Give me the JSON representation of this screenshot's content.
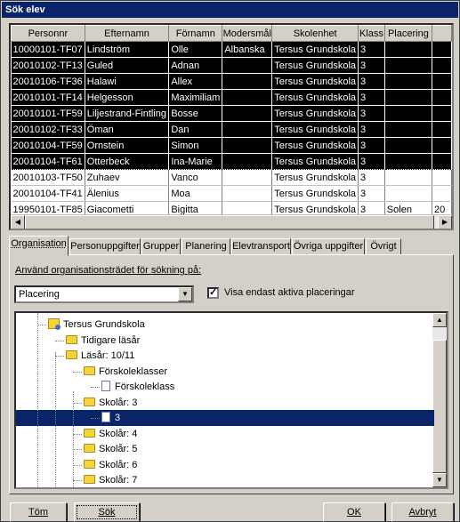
{
  "window": {
    "title": "Sök elev"
  },
  "grid": {
    "columns": [
      "Personnr",
      "Efternamn",
      "Förnamn",
      "Modersmål",
      "Skolenhet",
      "Klass",
      "Placering",
      ""
    ],
    "rows": [
      {
        "selected": true,
        "cells": [
          "10000101-TF07",
          "Lindström",
          "Olle",
          "Albanska",
          "Tersus Grundskola",
          "3",
          "",
          ""
        ]
      },
      {
        "selected": true,
        "cells": [
          "20010102-TF13",
          "Guled",
          "Adnan",
          "",
          "Tersus Grundskola",
          "3",
          "",
          ""
        ]
      },
      {
        "selected": true,
        "cells": [
          "20010106-TF36",
          "Halawi",
          "Allex",
          "",
          "Tersus Grundskola",
          "3",
          "",
          ""
        ]
      },
      {
        "selected": true,
        "cells": [
          "20010101-TF14",
          "Helgesson",
          "Maximiliam",
          "",
          "Tersus Grundskola",
          "3",
          "",
          ""
        ]
      },
      {
        "selected": true,
        "cells": [
          "20010101-TF59",
          "Liljestrand-Fintling",
          "Bosse",
          "",
          "Tersus Grundskola",
          "3",
          "",
          ""
        ]
      },
      {
        "selected": true,
        "cells": [
          "20010102-TF33",
          "Öman",
          "Dan",
          "",
          "Tersus Grundskola",
          "3",
          "",
          ""
        ]
      },
      {
        "selected": true,
        "cells": [
          "20010104-TF59",
          "Ornstein",
          "Simon",
          "",
          "Tersus Grundskola",
          "3",
          "",
          ""
        ]
      },
      {
        "selected": true,
        "current": true,
        "cells": [
          "20010104-TF61",
          "Otterbeck",
          "Ina-Marie",
          "",
          "Tersus Grundskola",
          "3",
          "",
          ""
        ]
      },
      {
        "selected": false,
        "cells": [
          "20010103-TF50",
          "Zuhaev",
          "Vanco",
          "",
          "Tersus Grundskola",
          "3",
          "",
          ""
        ]
      },
      {
        "selected": false,
        "cells": [
          "20010104-TF41",
          "Älenius",
          "Moa",
          "",
          "Tersus Grundskola",
          "3",
          "",
          ""
        ]
      },
      {
        "selected": false,
        "cells": [
          "19950101-TF85",
          "Giacometti",
          "Bigitta",
          "",
          "Tersus Grundskola",
          "3",
          "Solen",
          "20"
        ]
      }
    ]
  },
  "tabs": [
    {
      "label": "Organisation",
      "active": true
    },
    {
      "label": "Personuppgifter",
      "active": false
    },
    {
      "label": "Grupper",
      "active": false
    },
    {
      "label": "Planering",
      "active": false
    },
    {
      "label": "Elevtransport",
      "active": false
    },
    {
      "label": "Övriga uppgifter",
      "active": false
    },
    {
      "label": "Övrigt",
      "active": false
    }
  ],
  "organisation": {
    "search_label": "Använd organisationsträdet för sökning på:",
    "search_select_value": "Placering",
    "active_only_label": "Visa endast aktiva placeringar",
    "active_only_checked": true,
    "tree": [
      {
        "label": "Tersus Grundskola",
        "level": 0,
        "icon": "school-icon"
      },
      {
        "label": "Tidigare läsår",
        "level": 1,
        "icon": "folder-icon"
      },
      {
        "label": "Läsår: 10/11",
        "level": 1,
        "icon": "folder-icon"
      },
      {
        "label": "Förskoleklasser",
        "level": 2,
        "icon": "folder-icon"
      },
      {
        "label": "Förskoleklass",
        "level": 3,
        "icon": "page-icon"
      },
      {
        "label": "Skolår: 3",
        "level": 2,
        "icon": "folder-icon"
      },
      {
        "label": "3",
        "level": 3,
        "icon": "page-icon",
        "selected": true
      },
      {
        "label": "Skolår: 4",
        "level": 2,
        "icon": "folder-icon"
      },
      {
        "label": "Skolår: 5",
        "level": 2,
        "icon": "folder-icon"
      },
      {
        "label": "Skolår: 6",
        "level": 2,
        "icon": "folder-icon"
      },
      {
        "label": "Skolår: 7",
        "level": 2,
        "icon": "folder-icon"
      }
    ]
  },
  "buttons": {
    "clear": "Töm",
    "search": "Sök",
    "ok": "OK",
    "cancel": "Avbryt"
  }
}
